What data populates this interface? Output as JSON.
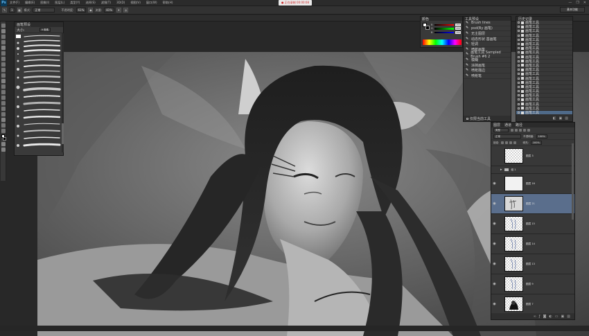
{
  "app": {
    "logo": "Ps"
  },
  "menubar": {
    "items": [
      "文件(F)",
      "编辑(E)",
      "图像(I)",
      "图层(L)",
      "类型(Y)",
      "选择(S)",
      "滤镜(T)",
      "3D(D)",
      "视图(V)",
      "窗口(W)",
      "帮助(H)"
    ],
    "recording_badge": "● 正在录制 00:00:08",
    "window_controls": [
      "—",
      "❐",
      "✕"
    ]
  },
  "optbar": {
    "brush_size": "1",
    "mode_label": "模式:",
    "mode_value": "正常",
    "opacity_label": "不透明度:",
    "opacity_value": "61%",
    "flow_label": "流量:",
    "flow_value": "81%",
    "workspace": "基本功能"
  },
  "brush_panel": {
    "tab": "画笔预设",
    "size_label": "大小:",
    "size_value": "9 像素"
  },
  "color_panel": {
    "tab": "颜色",
    "sliders": [
      {
        "label": "R",
        "value": "255",
        "gradient": "linear-gradient(90deg,#000,#f00)"
      },
      {
        "label": "G",
        "value": "255",
        "gradient": "linear-gradient(90deg,#000,#0f0)"
      },
      {
        "label": "B",
        "value": "255",
        "gradient": "linear-gradient(90deg,#000,#00f)"
      }
    ]
  },
  "history_panel": {
    "tab": "工具预设",
    "items": [
      "Brush lines",
      "psd(By 画笔)",
      "无主图层",
      "动态形状 基画笔",
      "轻调",
      "喷枪画笔",
      "画笔工具 Sampled Brush #6 2",
      "模糊",
      "涂抹画笔",
      "喷枪描边",
      "喷枪笔"
    ],
    "footer_checkbox": "仅限当前工具"
  },
  "actions_panel": {
    "tab": "历史记录",
    "items": [
      "画笔工具",
      "画笔工具",
      "画笔工具",
      "画笔工具",
      "画笔工具",
      "画笔工具",
      "画笔工具",
      "画笔工具",
      "画笔工具",
      "画笔工具",
      "画笔工具",
      "画笔工具",
      "画笔工具",
      "画笔工具",
      "画笔工具",
      "画笔工具",
      "画笔工具",
      "画笔工具",
      "画笔工具",
      "画笔工具",
      "画笔工具",
      "画笔工具"
    ],
    "selected_index": 21
  },
  "layers_panel": {
    "tabs": [
      "图层",
      "通道",
      "路径"
    ],
    "filter_label": "类型",
    "blend_mode": "正常",
    "opacity_label": "不透明度:",
    "opacity_value": "100%",
    "lock_label": "锁定:",
    "fill_label": "填充:",
    "fill_value": "100%",
    "layers": [
      {
        "name": "图层 3",
        "thumb": "check",
        "visible": false
      },
      {
        "name": "组 1",
        "group": true,
        "visible": false
      },
      {
        "name": "图层 16",
        "thumb": "white",
        "visible": true
      },
      {
        "name": "图层 21",
        "thumb": "sketch",
        "visible": true,
        "selected": true
      },
      {
        "name": "图层 15",
        "thumb": "check",
        "visible": true
      },
      {
        "name": "图层 14",
        "thumb": "check",
        "visible": true
      },
      {
        "name": "图层 13",
        "thumb": "check",
        "visible": true
      },
      {
        "name": "图层 9",
        "thumb": "check",
        "visible": true
      },
      {
        "name": "图层 7",
        "thumb": "silhouette",
        "visible": true
      }
    ]
  }
}
